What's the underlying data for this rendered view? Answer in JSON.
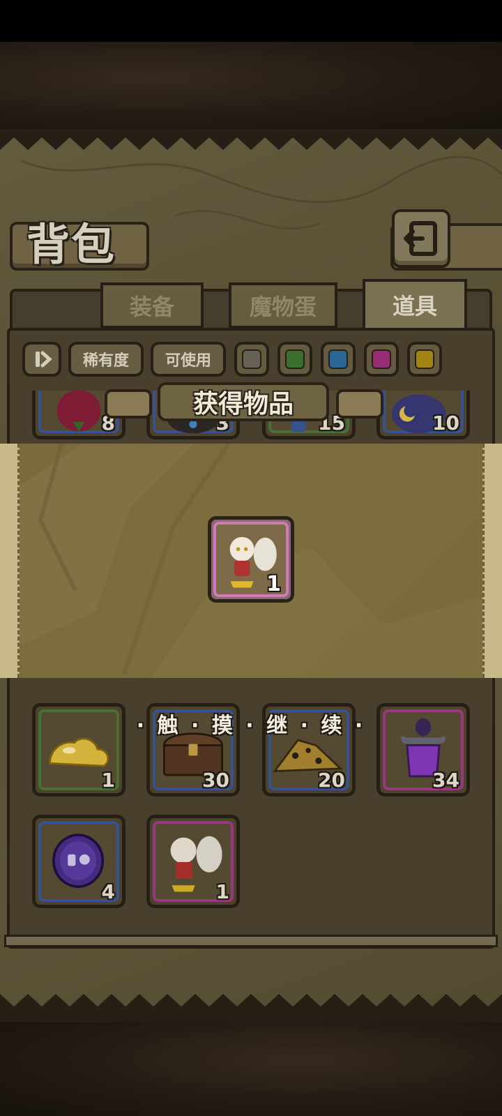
{
  "title": "背包",
  "tabs": [
    {
      "label": "装备",
      "active": false
    },
    {
      "label": "魔物蛋",
      "active": false
    },
    {
      "label": "道具",
      "active": true
    }
  ],
  "filters": {
    "sort_icon": "sort-toggle-icon",
    "rarity_label": "稀有度",
    "usable_label": "可使用",
    "rarity_colors": [
      "#6f6a5a",
      "#3f7a34",
      "#2f6fa6",
      "#a2327e",
      "#b09018"
    ]
  },
  "popup": {
    "title": "获得物品",
    "reward": {
      "icon": "rabbit-girl-figurine",
      "count": "1",
      "rarity_color": "#d27ab8"
    },
    "continue_label": "· 触 · 摸 · 继 · 续 ·"
  },
  "items_top_row": [
    {
      "icon": "red-flower-bulb",
      "count": "8"
    },
    {
      "icon": "paw-orb",
      "count": "3"
    },
    {
      "icon": "blue-vial",
      "count": "15"
    },
    {
      "icon": "moon-cloud",
      "count": "10"
    }
  ],
  "items": [
    {
      "icon": "gold-slime",
      "count": "1",
      "rarity_color": "#4e7a3a"
    },
    {
      "icon": "treasure-chest",
      "count": "30",
      "rarity_color": "#3c5aa0"
    },
    {
      "icon": "ore-pile",
      "count": "20",
      "rarity_color": "#3c5aa0"
    },
    {
      "icon": "purple-potion",
      "count": "34",
      "rarity_color": "#a83c8c"
    },
    {
      "icon": "rabbit-coin",
      "count": "4",
      "rarity_color": "#3c5aa0"
    },
    {
      "icon": "rabbit-girl-figurine",
      "count": "1",
      "rarity_color": "#a83c8c"
    }
  ],
  "back_icon": "return-arrow-icon"
}
